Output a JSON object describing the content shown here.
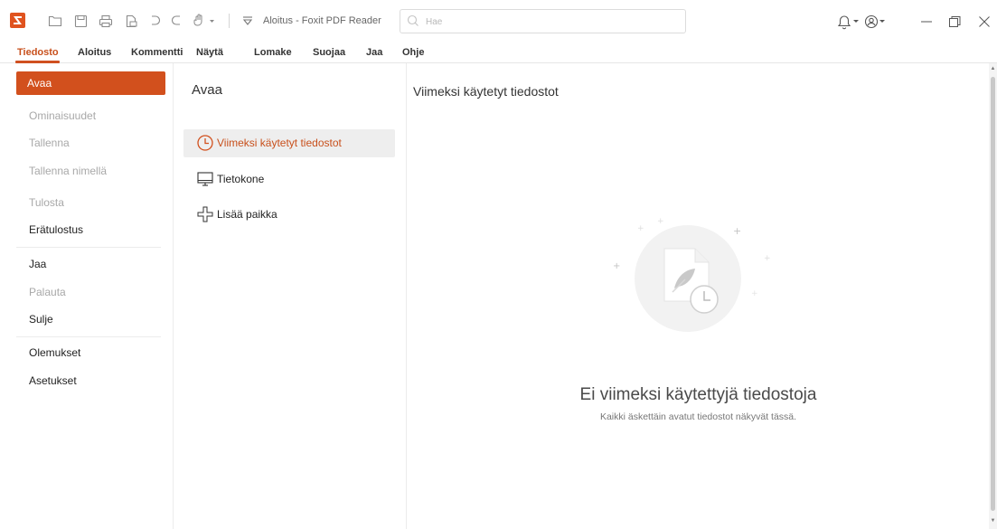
{
  "app": {
    "window_title": "Aloitus - Foxit PDF Reader",
    "brand_color": "#d2501d"
  },
  "quick_access": {
    "icons": [
      "open-folder-icon",
      "save-icon",
      "print-icon",
      "create-pdf-icon",
      "undo-icon",
      "redo-icon",
      "hand-tool-icon",
      "customize-toolbar-icon"
    ]
  },
  "search": {
    "placeholder": "Hae",
    "value": ""
  },
  "window_controls": {
    "icons": [
      "bell-icon",
      "account-icon",
      "minimize-icon",
      "restore-icon",
      "close-icon"
    ]
  },
  "ribbon": {
    "tabs": [
      {
        "label": "Tiedosto",
        "active": true
      },
      {
        "label": "Aloitus"
      },
      {
        "label": "Kommentti"
      },
      {
        "label": "Näytä"
      },
      {
        "label": "Lomake"
      },
      {
        "label": "Suojaa"
      },
      {
        "label": "Jaa"
      },
      {
        "label": "Ohje"
      }
    ]
  },
  "sidebar": {
    "items": [
      {
        "label": "Avaa",
        "state": "active"
      },
      {
        "label": "Ominaisuudet",
        "state": "disabled"
      },
      {
        "label": "Tallenna",
        "state": "disabled"
      },
      {
        "label": "Tallenna nimellä",
        "state": "disabled"
      },
      {
        "label": "Tulosta",
        "state": "disabled"
      },
      {
        "label": "Erätulostus",
        "state": "normal"
      },
      {
        "label": "Jaa",
        "state": "normal"
      },
      {
        "label": "Palauta",
        "state": "disabled"
      },
      {
        "label": "Sulje",
        "state": "normal"
      },
      {
        "label": "Olemukset",
        "state": "normal"
      },
      {
        "label": "Asetukset",
        "state": "normal"
      }
    ]
  },
  "open_panel": {
    "title": "Avaa",
    "locations": [
      {
        "label": "Viimeksi käytetyt tiedostot",
        "icon": "clock-icon",
        "selected": true
      },
      {
        "label": "Tietokone",
        "icon": "monitor-icon"
      },
      {
        "label": "Lisää paikka",
        "icon": "add-place-icon"
      }
    ]
  },
  "recent_panel": {
    "title": "Viimeksi käytetyt tiedostot",
    "empty_title": "Ei viimeksi käytettyjä tiedostoja",
    "empty_subtitle": "Kaikki äskettäin avatut tiedostot näkyvät tässä."
  }
}
